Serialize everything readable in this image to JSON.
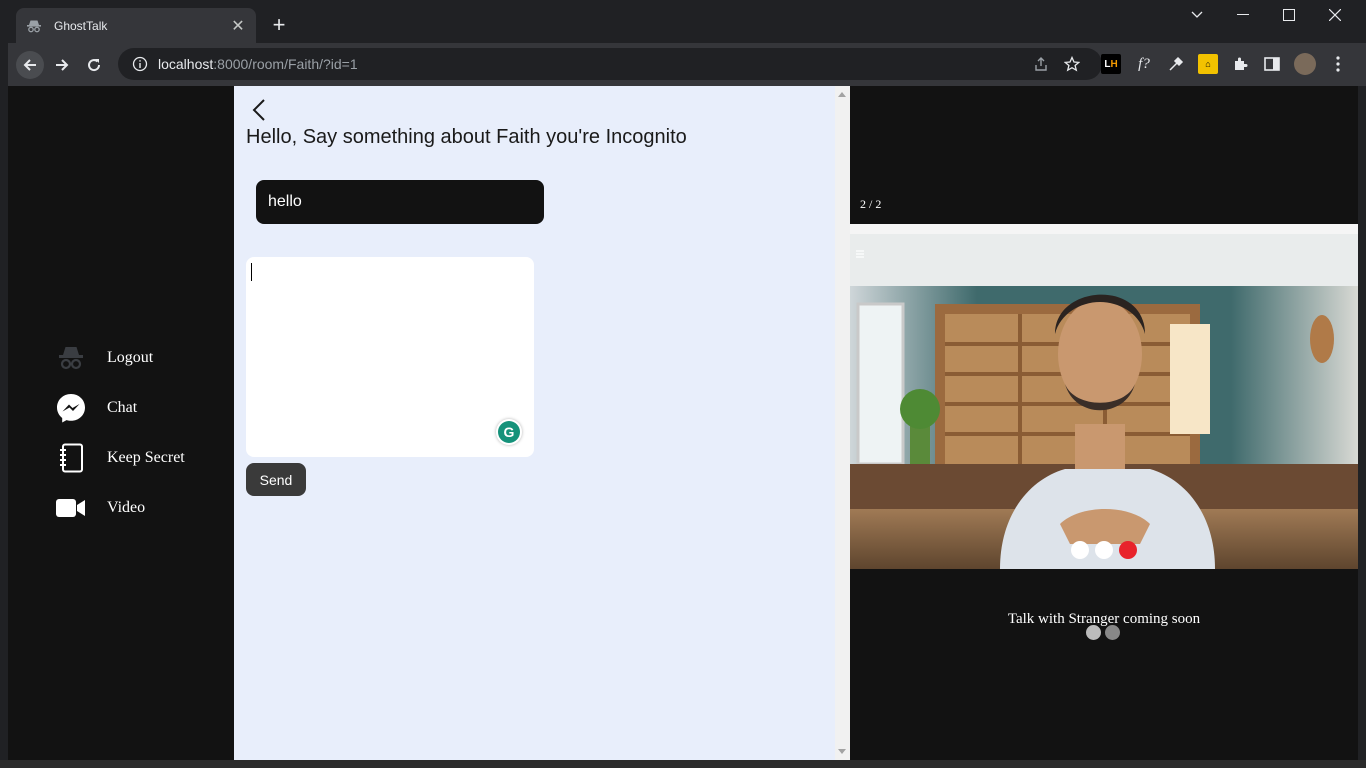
{
  "browser": {
    "tab_title": "GhostTalk",
    "url_host": "localhost",
    "url_path": ":8000/room/Faith/?id=1",
    "new_tab_symbol": "+"
  },
  "sidebar": {
    "items": [
      {
        "label": "Logout",
        "icon": "incognito-icon"
      },
      {
        "label": "Chat",
        "icon": "messenger-icon"
      },
      {
        "label": "Keep Secret",
        "icon": "notebook-icon"
      },
      {
        "label": "Video",
        "icon": "video-camera-icon"
      }
    ]
  },
  "main": {
    "heading": "Hello, Say something about Faith you're Incognito",
    "topic_value": "hello",
    "message_value": "",
    "grammarly_letter": "G",
    "send_label": "Send"
  },
  "right_panel": {
    "counter": "2 / 2",
    "coming_soon": "Talk with Stranger coming soon"
  },
  "colors": {
    "sidebar_bg": "#121212",
    "main_bg": "#e8eefb",
    "input_bg": "#121212",
    "send_bg": "#3a3a3a",
    "grammarly": "#15927a"
  }
}
